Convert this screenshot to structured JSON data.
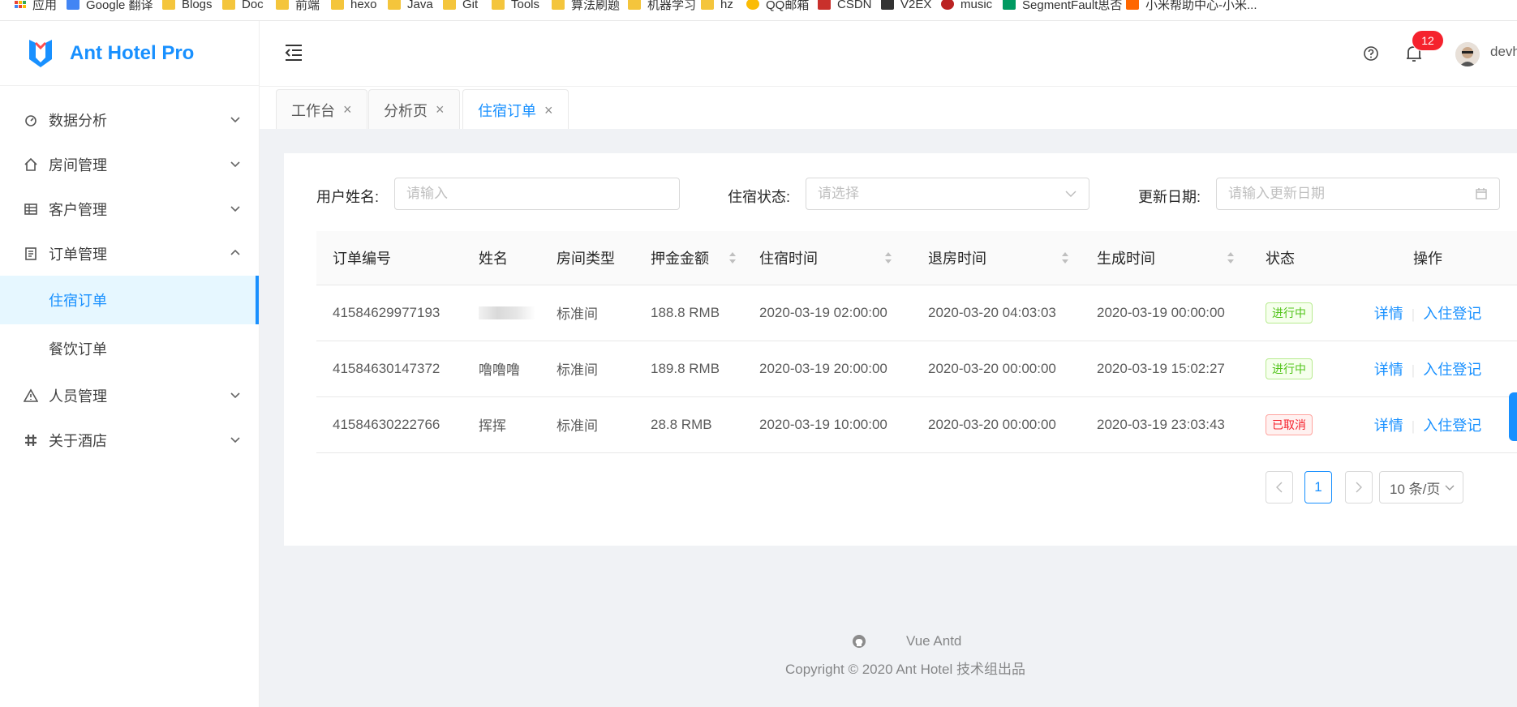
{
  "bookmarks": [
    {
      "label": "应用",
      "icon": "apps-grid-icon"
    },
    {
      "label": "Google 翻译",
      "icon": "google-translate-icon"
    },
    {
      "label": "Blogs",
      "icon": "folder-icon"
    },
    {
      "label": "Doc",
      "icon": "folder-icon"
    },
    {
      "label": "前端",
      "icon": "folder-icon"
    },
    {
      "label": "hexo",
      "icon": "folder-icon"
    },
    {
      "label": "Java",
      "icon": "folder-icon"
    },
    {
      "label": "Git",
      "icon": "folder-icon"
    },
    {
      "label": "Tools",
      "icon": "folder-icon"
    },
    {
      "label": "算法刷题",
      "icon": "folder-icon"
    },
    {
      "label": "机器学习",
      "icon": "folder-icon"
    },
    {
      "label": "hz",
      "icon": "folder-icon"
    },
    {
      "label": "QQ邮箱",
      "icon": "qq-mail-icon"
    },
    {
      "label": "CSDN",
      "icon": "csdn-icon"
    },
    {
      "label": "V2EX",
      "icon": "v2ex-icon"
    },
    {
      "label": "music",
      "icon": "music-icon"
    },
    {
      "label": "SegmentFault思否",
      "icon": "segmentfault-icon"
    },
    {
      "label": "小米帮助中心-小米...",
      "icon": "mi-icon"
    }
  ],
  "app": {
    "title": "Ant Hotel Pro"
  },
  "sidebar": {
    "items": [
      {
        "label": "数据分析",
        "icon": "dashboard-icon"
      },
      {
        "label": "房间管理",
        "icon": "home-icon"
      },
      {
        "label": "客户管理",
        "icon": "table-icon"
      },
      {
        "label": "订单管理",
        "icon": "profile-icon"
      },
      {
        "label": "人员管理",
        "icon": "warning-icon"
      },
      {
        "label": "关于酒店",
        "icon": "slack-icon"
      }
    ],
    "order_subitems": [
      "住宿订单",
      "餐饮订单"
    ]
  },
  "header": {
    "notification_count": "12",
    "username": "devh"
  },
  "tabs": [
    {
      "label": "工作台"
    },
    {
      "label": "分析页"
    },
    {
      "label": "住宿订单"
    }
  ],
  "filters": {
    "name_label": "用户姓名:",
    "name_placeholder": "请输入",
    "status_label": "住宿状态:",
    "status_placeholder": "请选择",
    "date_label": "更新日期:",
    "date_placeholder": "请输入更新日期"
  },
  "table": {
    "columns": [
      "订单编号",
      "姓名",
      "房间类型",
      "押金金额",
      "住宿时间",
      "退房时间",
      "生成时间",
      "状态",
      "操作"
    ],
    "rows": [
      {
        "id": "41584629977193",
        "name": "",
        "room": "标准间",
        "deposit": "188.8 RMB",
        "checkin": "2020-03-19 02:00:00",
        "checkout": "2020-03-20 04:03:03",
        "created": "2020-03-19 00:00:00",
        "status": "进行中"
      },
      {
        "id": "41584630147372",
        "name": "噜噜噜",
        "room": "标准间",
        "deposit": "189.8 RMB",
        "checkin": "2020-03-19 20:00:00",
        "checkout": "2020-03-20 00:00:00",
        "created": "2020-03-19 15:02:27",
        "status": "进行中"
      },
      {
        "id": "41584630222766",
        "name": "挥挥",
        "room": "标准间",
        "deposit": "28.8 RMB",
        "checkin": "2020-03-19 10:00:00",
        "checkout": "2020-03-20 00:00:00",
        "created": "2020-03-19 23:03:43",
        "status": "已取消"
      }
    ],
    "action_detail": "详情",
    "action_checkin": "入住登记"
  },
  "pagination": {
    "current": "1",
    "page_size": "10 条/页"
  },
  "footer": {
    "link": "Vue Antd",
    "copyright": "Copyright © 2020 Ant Hotel 技术组出品"
  },
  "colors": {
    "primary": "#1890ff",
    "success": "#52c41a",
    "error": "#f5222d"
  }
}
